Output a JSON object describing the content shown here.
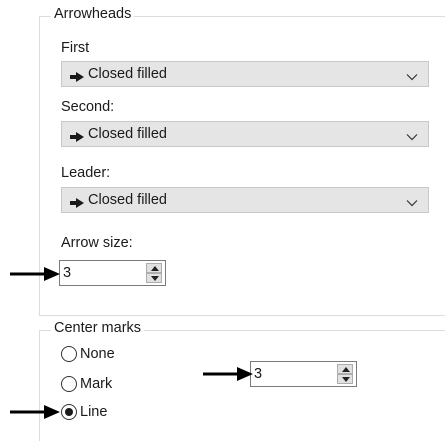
{
  "arrowheads": {
    "title": "Arrowheads",
    "first": {
      "label": "First",
      "value": "Closed filled"
    },
    "second": {
      "label": "Second:",
      "value": "Closed filled"
    },
    "leader": {
      "label": "Leader:",
      "value": "Closed filled"
    },
    "arrow_size": {
      "label": "Arrow size:",
      "value": "3"
    }
  },
  "center_marks": {
    "title": "Center marks",
    "options": [
      {
        "label": "None",
        "checked": false
      },
      {
        "label": "Mark",
        "checked": false
      },
      {
        "label": "Line",
        "checked": true
      }
    ],
    "size_value": "3"
  },
  "colors": {
    "combo_bg": "#e5e5e5",
    "group_border": "#dcdcdc",
    "pointer": "#000000"
  }
}
